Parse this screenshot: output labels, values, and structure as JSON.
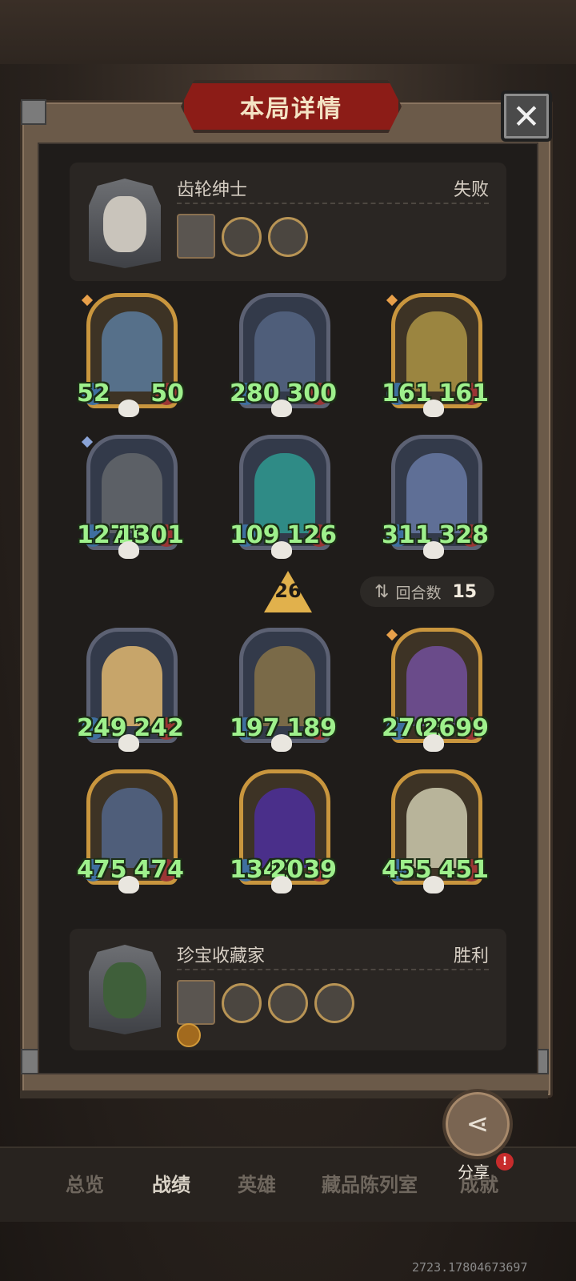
{
  "title": "本局详情",
  "close_label": "✕",
  "top_player": {
    "name": "齿轮绅士",
    "result": "失败"
  },
  "bottom_player": {
    "name": "珍宝收藏家",
    "result": "胜利"
  },
  "round": "26",
  "turns": {
    "icon": "swap-icon",
    "label": "回合数",
    "value": "15"
  },
  "top_cards": [
    {
      "atk": "52",
      "hp": "50",
      "frame": "gold",
      "gem": "gold",
      "art": "#56708a"
    },
    {
      "atk": "280",
      "hp": "300",
      "frame": "silver",
      "gem": "",
      "art": "#4f5e7a"
    },
    {
      "atk": "161",
      "hp": "161",
      "frame": "gold",
      "gem": "gold",
      "art": "#9b8540"
    },
    {
      "atk": "1271",
      "hp": "1301",
      "frame": "silver",
      "gem": "blue",
      "art": "#5c6066"
    },
    {
      "atk": "109",
      "hp": "126",
      "frame": "silver",
      "gem": "",
      "art": "#2f8b86"
    },
    {
      "atk": "311",
      "hp": "328",
      "frame": "silver",
      "gem": "",
      "art": "#5f6f96"
    }
  ],
  "bottom_cards": [
    {
      "atk": "249",
      "hp": "242",
      "frame": "silver",
      "gem": "",
      "art": "#c7a56a"
    },
    {
      "atk": "197",
      "hp": "189",
      "frame": "silver",
      "gem": "",
      "art": "#7a6a48"
    },
    {
      "atk": "2705",
      "hp": "2699",
      "frame": "gold",
      "gem": "gold",
      "art": "#6a4b8a"
    },
    {
      "atk": "475",
      "hp": "474",
      "frame": "gold",
      "gem": "",
      "art": "#4f5e7a"
    },
    {
      "atk": "1343",
      "hp": "2039",
      "frame": "gold",
      "gem": "",
      "art": "#4a2f8a"
    },
    {
      "atk": "455",
      "hp": "451",
      "frame": "gold",
      "gem": "",
      "art": "#b8b49a"
    }
  ],
  "tabs": [
    "总览",
    "战绩",
    "英雄",
    "藏品陈列室",
    "成就"
  ],
  "active_tab": "战绩",
  "share_label": "分享",
  "share_badge": "!",
  "coords": "2723.17804673697"
}
